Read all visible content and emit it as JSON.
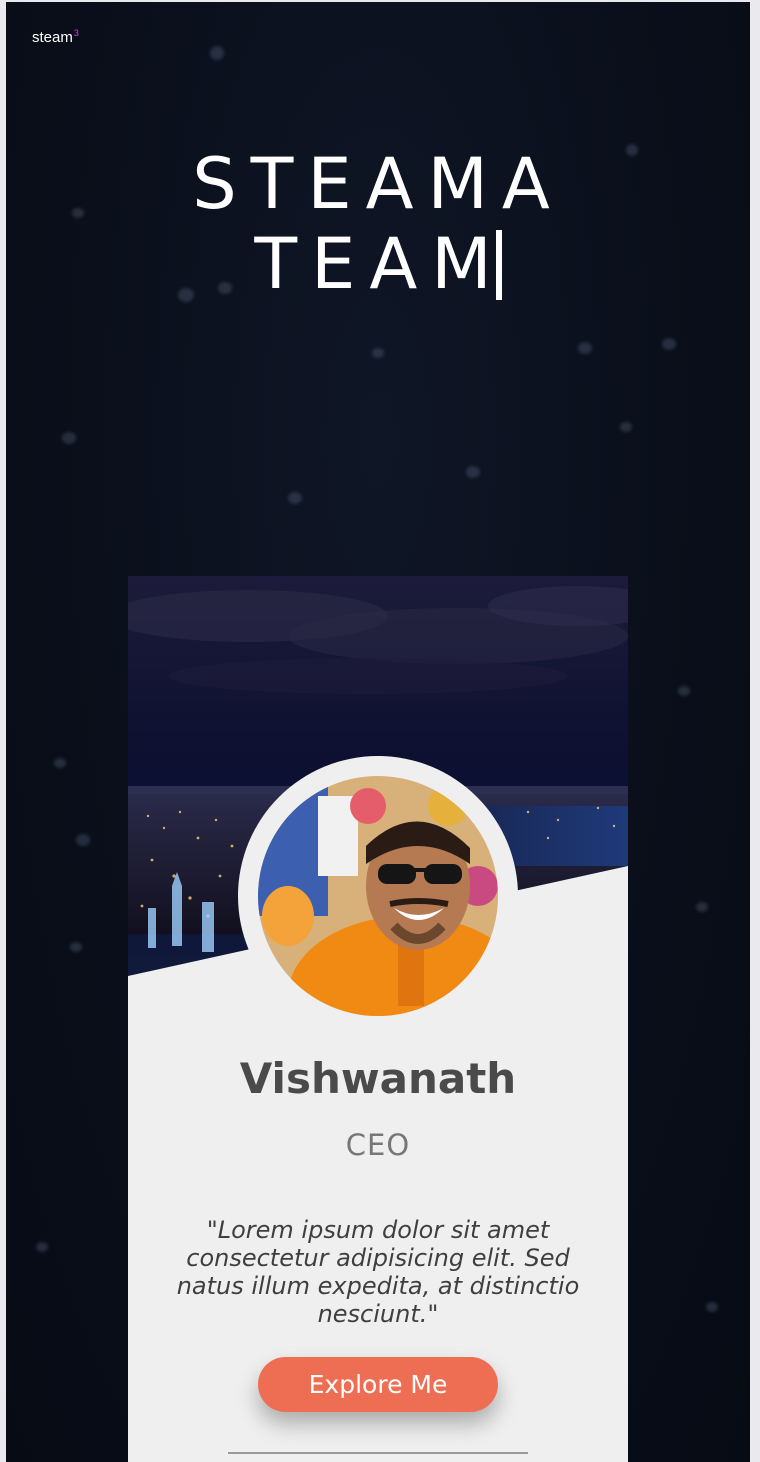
{
  "brand": {
    "name": "steam",
    "superscript": "3"
  },
  "hero": {
    "line1": "STEAMA",
    "line2": "TEAM"
  },
  "profile": {
    "name": "Vishwanath",
    "role": "CEO",
    "quote": "\"Lorem ipsum dolor sit amet consectetur adipisicing elit. Sed natus illum expedita, at distinctio nesciunt.\"",
    "button_label": "Explore Me"
  },
  "colors": {
    "accent": "#ee6e53",
    "card_background": "#efefef",
    "page_background": "#0a0f1b"
  }
}
